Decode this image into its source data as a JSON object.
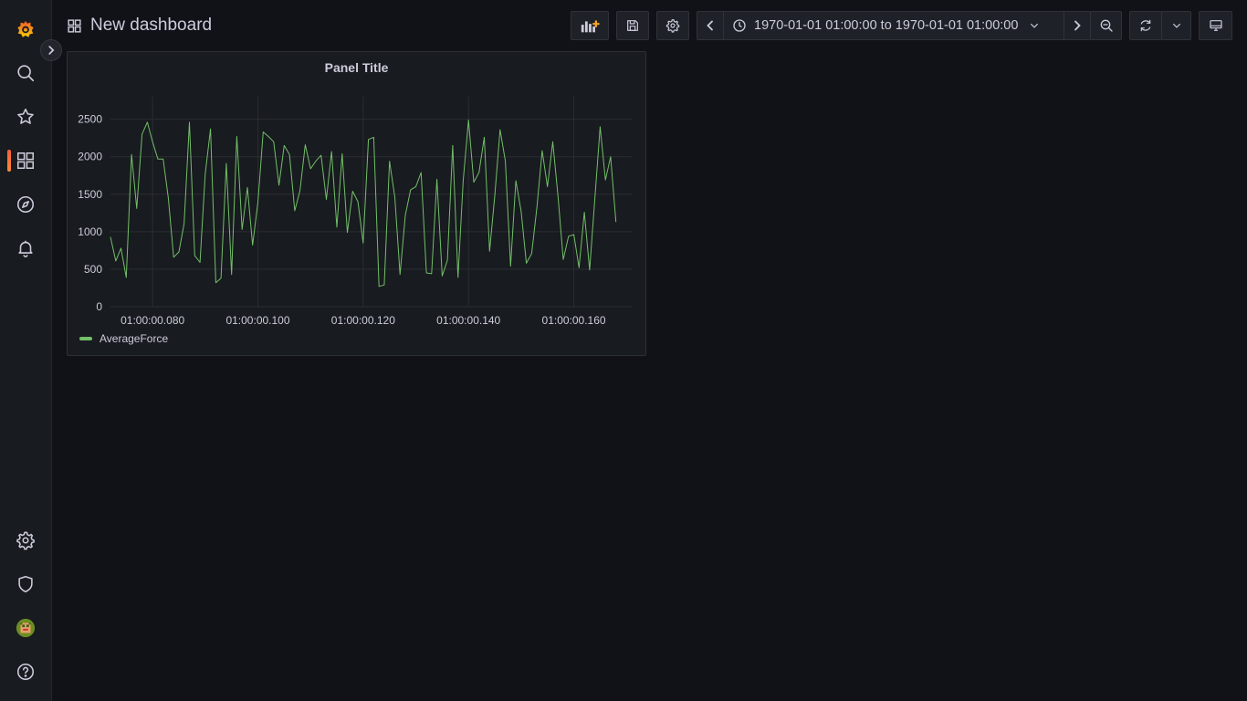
{
  "header": {
    "title": "New dashboard",
    "time_range": "1970-01-01 01:00:00 to 1970-01-01 01:00:00"
  },
  "colors": {
    "background": "#111217",
    "sidebar": "#181b1f",
    "panel": "#181b1f",
    "series": "#73bf69",
    "accent": "#f55f3e"
  },
  "sidebar": {
    "top_items": [
      "grafana-logo-icon",
      "search-icon",
      "star-icon",
      "dashboards-icon",
      "compass-icon",
      "bell-icon"
    ],
    "bottom_items": [
      "gear-icon",
      "shield-icon",
      "avatar",
      "help-icon"
    ],
    "active": "dashboards-icon"
  },
  "toolbar": [
    "add-panel-icon",
    "save-icon",
    "settings-icon",
    "time-back-icon",
    "clock-icon",
    "chevron-down-icon",
    "time-forward-icon",
    "zoom-out-icon",
    "refresh-icon",
    "chevron-down-icon",
    "tv-icon"
  ],
  "panel": {
    "title": "Panel Title",
    "legend": "AverageForce"
  },
  "chart_data": {
    "type": "line",
    "series": [
      {
        "name": "AverageForce",
        "x_ms": [
          72,
          73,
          74,
          75,
          76,
          77,
          78,
          79,
          80,
          81,
          82,
          83,
          84,
          85,
          86,
          87,
          88,
          89,
          90,
          91,
          92,
          93,
          94,
          95,
          96,
          97,
          98,
          99,
          100,
          101,
          102,
          103,
          104,
          105,
          106,
          107,
          108,
          109,
          110,
          111,
          112,
          113,
          114,
          115,
          116,
          117,
          118,
          119,
          120,
          121,
          122,
          123,
          124,
          125,
          126,
          127,
          128,
          129,
          130,
          131,
          132,
          133,
          134,
          135,
          136,
          137,
          138,
          139,
          140,
          141,
          142,
          143,
          144,
          145,
          146,
          147,
          148,
          149,
          150,
          151,
          152,
          153,
          154,
          155,
          156,
          157,
          158,
          159,
          160,
          161,
          162,
          163,
          164,
          165,
          166,
          167,
          168,
          169,
          170,
          171
        ],
        "values": [
          930,
          610,
          780,
          390,
          2030,
          1310,
          2300,
          2460,
          2200,
          1970,
          1970,
          1450,
          660,
          730,
          1110,
          2460,
          680,
          590,
          1770,
          2370,
          320,
          380,
          1910,
          430,
          2270,
          1030,
          1590,
          820,
          1390,
          2330,
          2270,
          2200,
          1620,
          2150,
          2030,
          1280,
          1550,
          2160,
          1840,
          1940,
          2020,
          1430,
          2070,
          1060,
          2040,
          990,
          1540,
          1400,
          850,
          2230,
          2260,
          270,
          290,
          1940,
          1460,
          430,
          1220,
          1560,
          1600,
          1790,
          450,
          440,
          1700,
          410,
          620,
          2150,
          390,
          1680,
          2490,
          1660,
          1790,
          2260,
          740,
          1480,
          2360,
          1940,
          540,
          1680,
          1270,
          580,
          710,
          1330,
          2080,
          1600,
          2200,
          1470,
          630,
          940,
          960,
          520,
          1260,
          490,
          1440,
          2400,
          1690,
          2000,
          1130
        ]
      }
    ],
    "x_tick_labels": [
      "01:00:00.080",
      "01:00:00.100",
      "01:00:00.120",
      "01:00:00.140",
      "01:00:00.160"
    ],
    "x_tick_values_ms": [
      80,
      100,
      120,
      140,
      160
    ],
    "y_ticks": [
      0,
      500,
      1000,
      1500,
      2000,
      2500
    ],
    "xlim_ms": [
      72,
      171
    ],
    "ylim": [
      0,
      2800
    ],
    "grid": true,
    "legend_placement": "bottom-left"
  }
}
